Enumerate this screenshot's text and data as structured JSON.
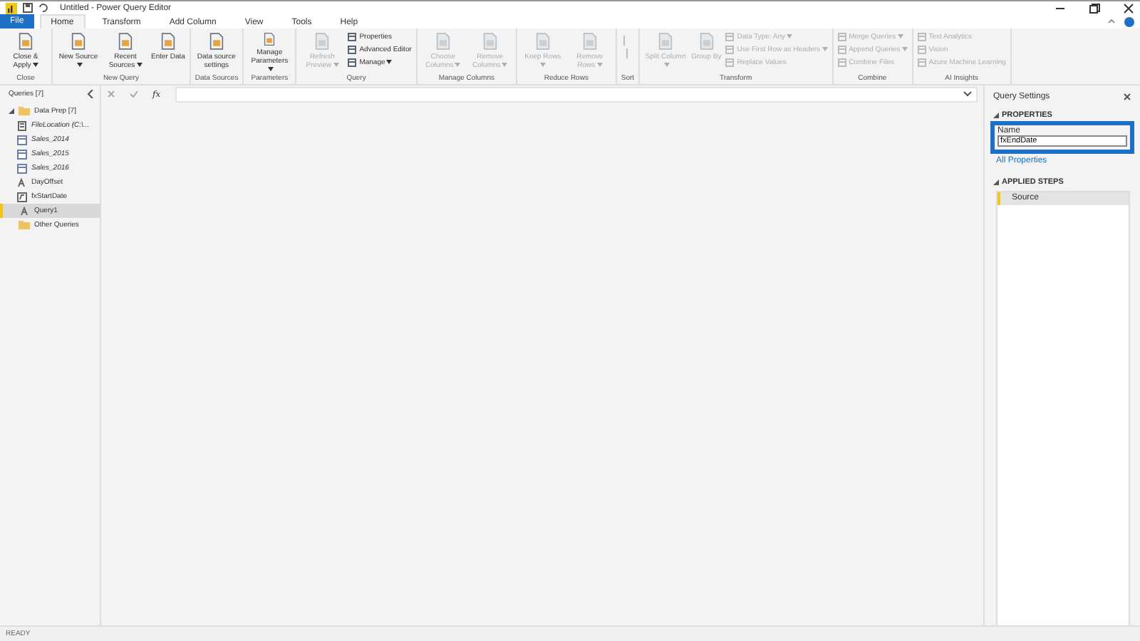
{
  "window": {
    "title": "Untitled - Power Query Editor"
  },
  "tabs": [
    {
      "label": "File",
      "kind": "file",
      "selected": false
    },
    {
      "label": "Home",
      "kind": "tab",
      "selected": true
    },
    {
      "label": "Transform",
      "kind": "tab",
      "selected": false
    },
    {
      "label": "Add Column",
      "kind": "tab",
      "selected": false
    },
    {
      "label": "View",
      "kind": "tab",
      "selected": false
    },
    {
      "label": "Tools",
      "kind": "tab",
      "selected": false
    },
    {
      "label": "Help",
      "kind": "tab",
      "selected": false
    }
  ],
  "ribbon": [
    {
      "group": "Close",
      "buttons": [
        {
          "label": "Close & Apply",
          "kind": "large",
          "dropdown": true,
          "disabled": false
        }
      ]
    },
    {
      "group": "New Query",
      "buttons": [
        {
          "label": "New Source",
          "kind": "large",
          "dropdown": true,
          "disabled": false
        },
        {
          "label": "Recent Sources",
          "kind": "large",
          "dropdown": true,
          "disabled": false
        },
        {
          "label": "Enter Data",
          "kind": "large",
          "dropdown": false,
          "disabled": false
        }
      ]
    },
    {
      "group": "Data Sources",
      "buttons": [
        {
          "label": "Data source settings",
          "kind": "large",
          "dropdown": false,
          "disabled": false
        }
      ]
    },
    {
      "group": "Parameters",
      "buttons": [
        {
          "label": "Manage Parameters",
          "kind": "large",
          "dropdown": true,
          "disabled": false
        }
      ]
    },
    {
      "group": "Query",
      "buttons": [
        {
          "label": "Refresh Preview",
          "kind": "large",
          "dropdown": true,
          "disabled": true
        },
        {
          "label": "Properties",
          "kind": "small",
          "dropdown": false,
          "disabled": false
        },
        {
          "label": "Advanced Editor",
          "kind": "small",
          "dropdown": false,
          "disabled": false
        },
        {
          "label": "Manage",
          "kind": "small",
          "dropdown": true,
          "disabled": false
        }
      ]
    },
    {
      "group": "Manage Columns",
      "buttons": [
        {
          "label": "Choose Columns",
          "kind": "large",
          "dropdown": true,
          "disabled": true
        },
        {
          "label": "Remove Columns",
          "kind": "large",
          "dropdown": true,
          "disabled": true
        }
      ]
    },
    {
      "group": "Reduce Rows",
      "buttons": [
        {
          "label": "Keep Rows",
          "kind": "large",
          "dropdown": true,
          "disabled": true
        },
        {
          "label": "Remove Rows",
          "kind": "large",
          "dropdown": true,
          "disabled": true
        }
      ]
    },
    {
      "group": "Sort",
      "buttons": [
        {
          "kind": "sort",
          "disabled": true
        }
      ]
    },
    {
      "group": "Transform",
      "buttons": [
        {
          "label": "Split Column",
          "kind": "large",
          "dropdown": true,
          "disabled": true
        },
        {
          "label": "Group By",
          "kind": "large",
          "dropdown": false,
          "disabled": true
        },
        {
          "label": "Data Type: Any",
          "kind": "small",
          "dropdown": true,
          "disabled": true
        },
        {
          "label": "Use First Row as Headers",
          "kind": "small",
          "dropdown": true,
          "disabled": true
        },
        {
          "label": "Replace Values",
          "kind": "small",
          "dropdown": false,
          "disabled": true
        }
      ]
    },
    {
      "group": "Combine",
      "buttons": [
        {
          "label": "Merge Queries",
          "kind": "small",
          "dropdown": true,
          "disabled": true
        },
        {
          "label": "Append Queries",
          "kind": "small",
          "dropdown": true,
          "disabled": true
        },
        {
          "label": "Combine Files",
          "kind": "small",
          "dropdown": false,
          "disabled": true
        }
      ]
    },
    {
      "group": "AI Insights",
      "buttons": [
        {
          "label": "Text Analytics",
          "kind": "small",
          "dropdown": false,
          "disabled": true
        },
        {
          "label": "Vision",
          "kind": "small",
          "dropdown": false,
          "disabled": true
        },
        {
          "label": "Azure Machine Learning",
          "kind": "small",
          "dropdown": false,
          "disabled": true
        }
      ]
    }
  ],
  "queries": {
    "title": "Queries [7]",
    "items": [
      {
        "label": "Data Prep [7]",
        "kind": "folder",
        "expanded": true,
        "selected": false,
        "children": [
          {
            "label": "FileLocation (C:\\...",
            "kind": "parameter",
            "selected": false,
            "italic": true
          },
          {
            "label": "Sales_2014",
            "kind": "table",
            "selected": false,
            "italic": true
          },
          {
            "label": "Sales_2015",
            "kind": "table",
            "selected": false,
            "italic": true
          },
          {
            "label": "Sales_2016",
            "kind": "table",
            "selected": false,
            "italic": true
          },
          {
            "label": "DayOffset",
            "kind": "value",
            "selected": false,
            "italic": false
          },
          {
            "label": "fxStartDate",
            "kind": "function",
            "selected": false,
            "italic": false
          },
          {
            "label": "Query1",
            "kind": "value",
            "selected": true,
            "italic": false
          }
        ]
      },
      {
        "label": "Other Queries",
        "kind": "folder",
        "expanded": false,
        "selected": false
      }
    ]
  },
  "formula_bar": {
    "fx": "fx"
  },
  "settings": {
    "title": "Query Settings",
    "properties_heading": "PROPERTIES",
    "name_label": "Name",
    "name_value": "fxEndDate",
    "all_properties": "All Properties",
    "steps_heading": "APPLIED STEPS",
    "steps": [
      {
        "label": "Source",
        "selected": true
      }
    ]
  },
  "status_bar": "READY"
}
